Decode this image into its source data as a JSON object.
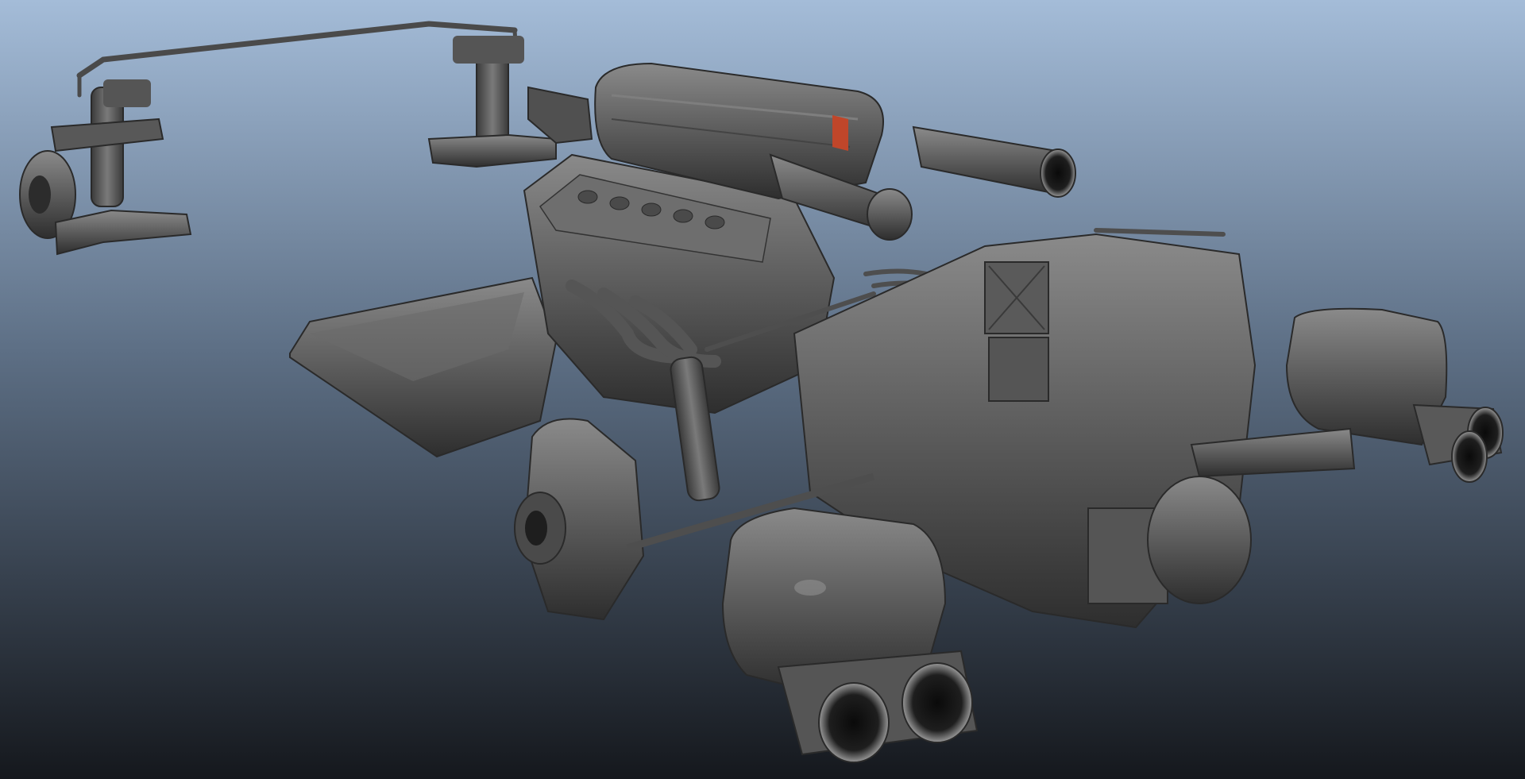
{
  "viewport": {
    "background_top": "#a4bcd8",
    "background_mid": "#5d6f85",
    "background_bottom": "#15181d",
    "model_fill": "#5c5c5c",
    "model_light": "#8a8a8a",
    "model_dark": "#2e2e2e",
    "accent_part": "#c0462a"
  },
  "objects": [
    "front-suspension-left",
    "anti-roll-bar",
    "front-suspension-right",
    "v12-engine",
    "intake-plenum",
    "air-intake-left",
    "air-intake-right",
    "exhaust-manifold",
    "oil-pan",
    "transmission",
    "wiring-loom",
    "rear-suspension-left",
    "rear-muffler-right",
    "rear-muffler-left",
    "exhaust-tips-right",
    "exhaust-tips-left"
  ]
}
